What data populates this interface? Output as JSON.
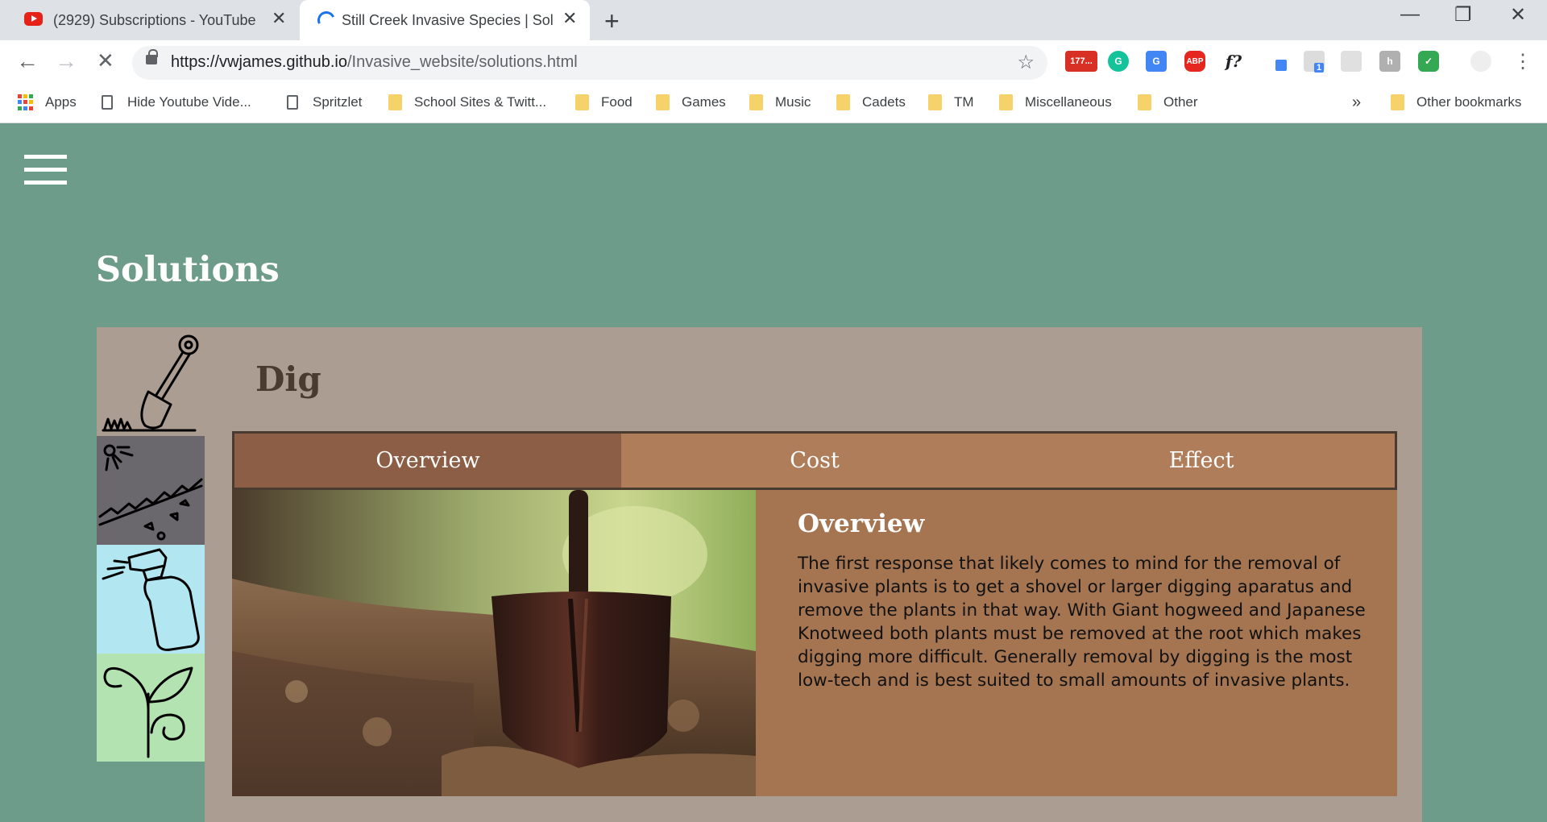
{
  "browser": {
    "tabs": [
      {
        "title": "(2929) Subscriptions - YouTube",
        "active": false
      },
      {
        "title": "Still Creek Invasive Species | Solu",
        "active": true
      }
    ],
    "new_tab": "+",
    "window_controls": [
      "—",
      "❐",
      "✕"
    ],
    "url": {
      "host": "https://vwjames.github.io",
      "path": "/Invasive_website/solutions.html"
    },
    "extensions": [
      {
        "icon": "gmail-icon",
        "label": "177...",
        "color": "#d93025"
      },
      {
        "icon": "grammarly-icon",
        "label": "G",
        "color": "#15c39a"
      },
      {
        "icon": "translate-icon",
        "label": "G",
        "color": "#4285f4"
      },
      {
        "icon": "adblock-icon",
        "label": "ABP",
        "color": "#e5271f"
      },
      {
        "icon": "formula-icon",
        "label": "f?",
        "color": "#ffffff"
      },
      {
        "icon": "eyedropper-icon",
        "label": "",
        "color": "#4285f4"
      },
      {
        "icon": "s-badge-icon",
        "label": "1",
        "color": "#4285f4"
      },
      {
        "icon": "cube-icon",
        "label": "",
        "color": "#bdbdbd"
      },
      {
        "icon": "h-icon",
        "label": "h",
        "color": "#9e9e9e"
      },
      {
        "icon": "shield-check-icon",
        "label": "",
        "color": "#34a853"
      }
    ],
    "bookmarks": [
      "Apps",
      "Hide Youtube Vide...",
      "Spritzlet",
      "School Sites & Twitt...",
      "Food",
      "Games",
      "Music",
      "Cadets",
      "TM",
      "Miscellaneous",
      "Other"
    ],
    "bookmarks_overflow": "»",
    "other_bookmarks": "Other bookmarks"
  },
  "page": {
    "title": "Solutions",
    "section_title": "Dig",
    "tabs": [
      "Overview",
      "Cost",
      "Effect"
    ],
    "active_tab": "Overview",
    "content_title": "Overview",
    "content_text": "The first response that likely comes to mind for the removal of invasive plants is to get a shovel or larger digging aparatus and remove the plants in that way. With Giant hogweed and Japanese Knotweed both plants must be removed at the root which makes digging more difficult. Generally removal by digging is the most low-tech and is best suited to small amounts of invasive plants.",
    "solution_icons": [
      "shovel-icon",
      "tarp-cover-icon",
      "spray-bottle-icon",
      "sprout-icon"
    ],
    "colors": {
      "background": "#6d9c8b",
      "panel": "#ab9d91",
      "tab_bar": "#b07d5a",
      "tab_active": "#8b5e45",
      "content_box": "#a57552"
    }
  }
}
